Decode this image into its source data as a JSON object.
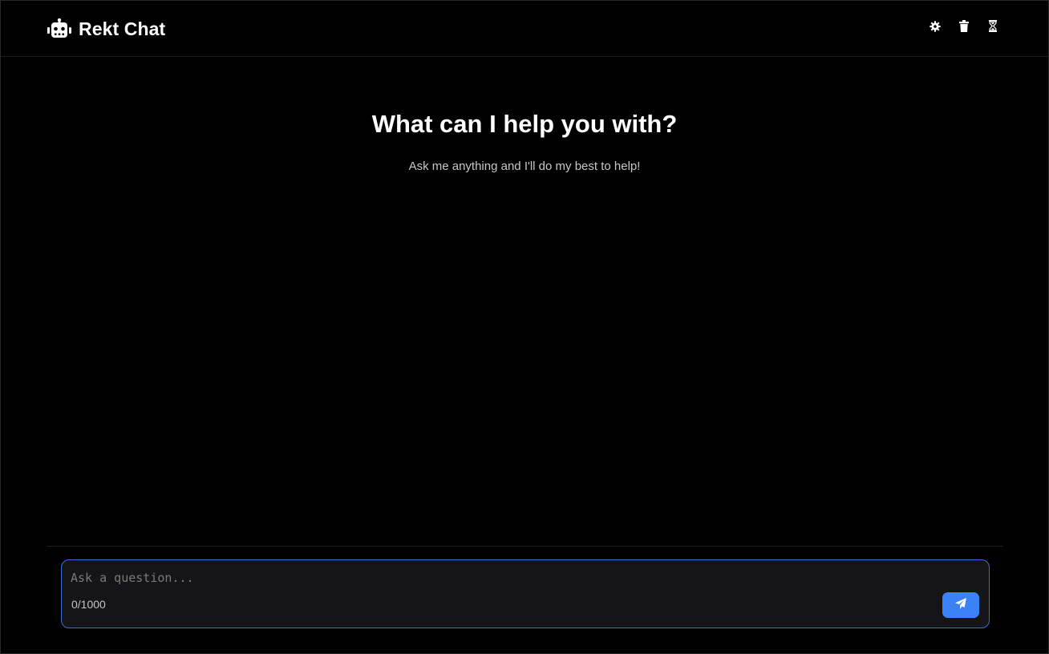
{
  "header": {
    "title": "Rekt Chat",
    "logo_icon": "robot-icon",
    "actions": [
      {
        "name": "settings",
        "icon": "gear-icon"
      },
      {
        "name": "clear-chat",
        "icon": "trash-icon"
      },
      {
        "name": "history",
        "icon": "hourglass-icon"
      }
    ]
  },
  "welcome": {
    "title": "What can I help you with?",
    "subtitle": "Ask me anything and I'll do my best to help!"
  },
  "composer": {
    "placeholder": "Ask a question...",
    "value": "",
    "char_count": "0/1000",
    "send_icon": "paper-plane-icon"
  },
  "colors": {
    "background": "#000000",
    "accent": "#3b82f6",
    "composer_border": "#3b6fd8",
    "composer_bg": "#151518"
  }
}
